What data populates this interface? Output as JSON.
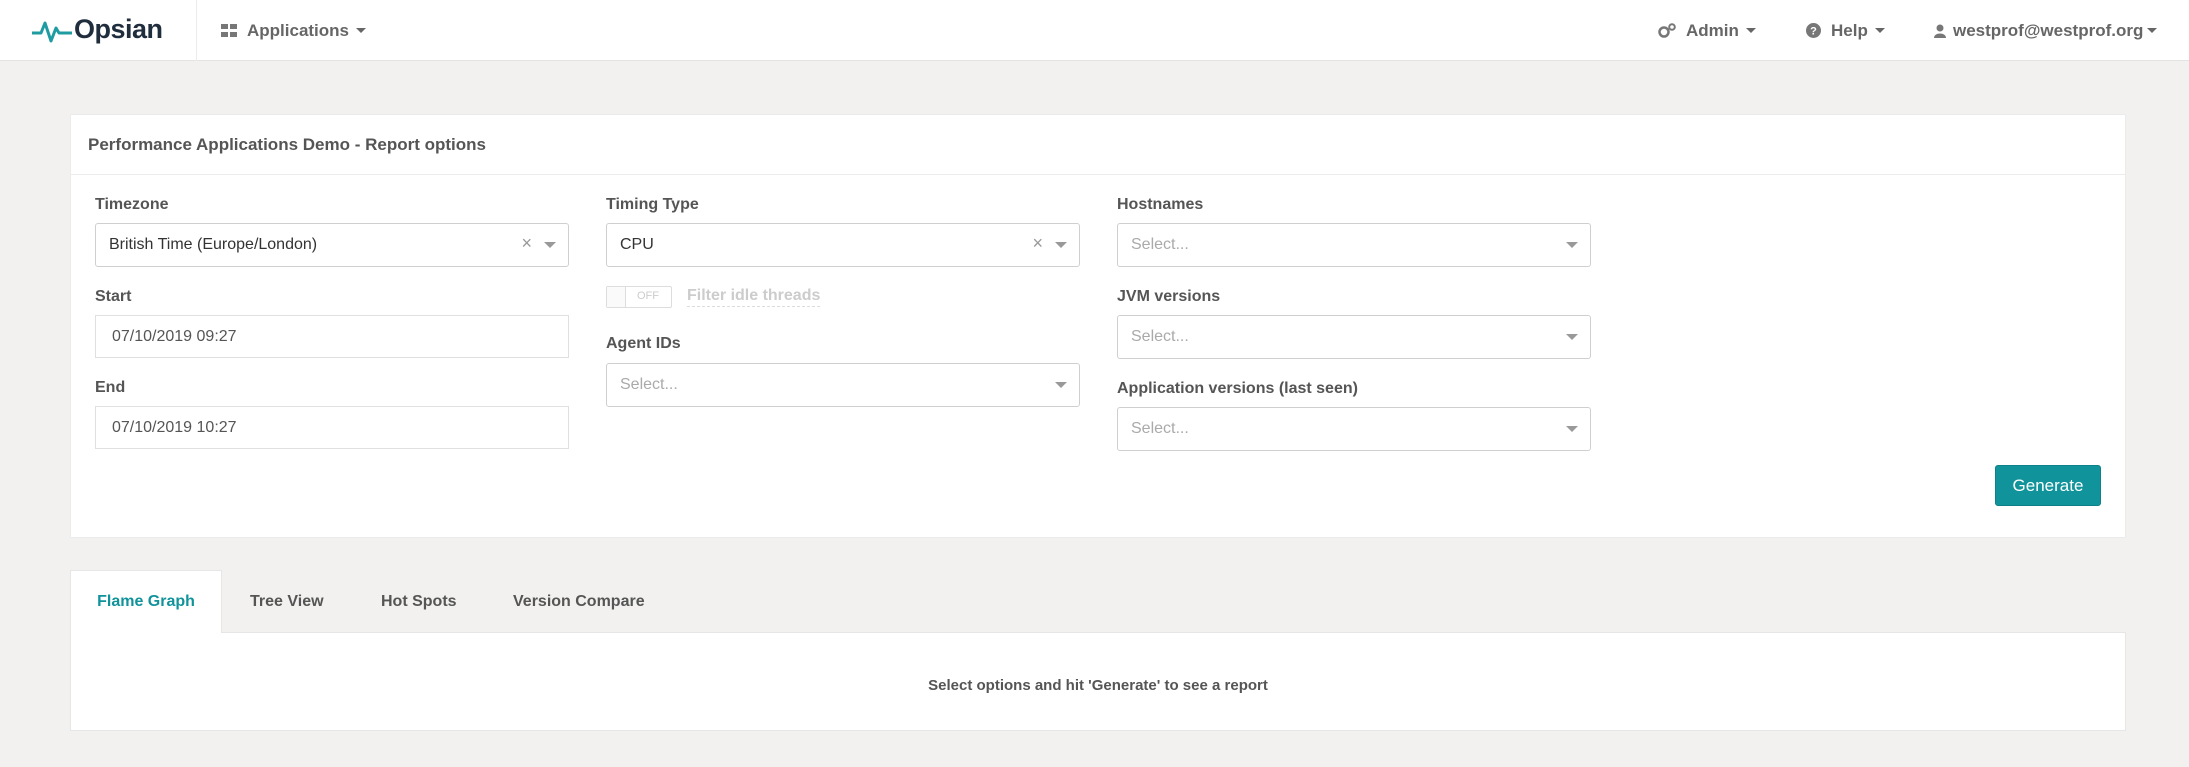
{
  "navbar": {
    "brand": "Opsian",
    "applications_label": "Applications",
    "admin_label": "Admin",
    "help_label": "Help",
    "user_label": "westprof@westprof.org"
  },
  "report_options": {
    "title": "Performance Applications Demo - Report options",
    "timezone": {
      "label": "Timezone",
      "value": "British Time (Europe/London)",
      "clear": "×"
    },
    "start": {
      "label": "Start",
      "value": "07/10/2019 09:27"
    },
    "end": {
      "label": "End",
      "value": "07/10/2019 10:27"
    },
    "timing_type": {
      "label": "Timing Type",
      "value": "CPU",
      "clear": "×"
    },
    "filter_idle": {
      "state": "OFF",
      "label": "Filter idle threads"
    },
    "agent_ids": {
      "label": "Agent IDs",
      "placeholder": "Select..."
    },
    "hostnames": {
      "label": "Hostnames",
      "placeholder": "Select..."
    },
    "jvm_versions": {
      "label": "JVM versions",
      "placeholder": "Select..."
    },
    "app_versions": {
      "label": "Application versions (last seen)",
      "placeholder": "Select..."
    },
    "generate_label": "Generate"
  },
  "tabs": [
    {
      "label": "Flame Graph",
      "active": true
    },
    {
      "label": "Tree View"
    },
    {
      "label": "Hot Spots"
    },
    {
      "label": "Version Compare"
    }
  ],
  "tab_message": "Select options and hit 'Generate' to see a report",
  "colors": {
    "accent": "#10939a",
    "background": "#f2f1ef"
  }
}
